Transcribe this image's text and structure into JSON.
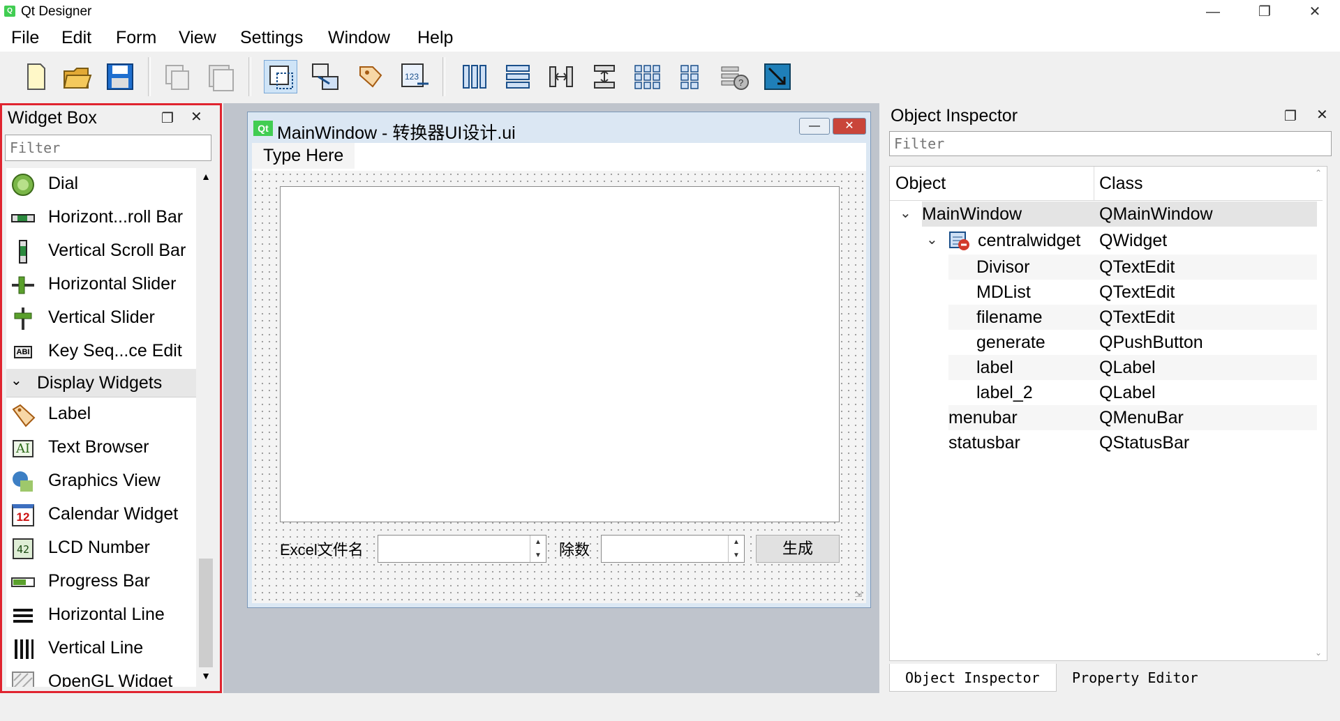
{
  "window": {
    "title": "Qt Designer",
    "icon_text": "Q"
  },
  "menubar": {
    "items": [
      "File",
      "Edit",
      "Form",
      "View",
      "Settings",
      "Window",
      "Help"
    ]
  },
  "toolbar": {
    "buttons": [
      "new-file",
      "open-folder",
      "save",
      "copy",
      "paste",
      "edit-widgets",
      "edit-signals",
      "edit-buddies",
      "edit-tab-order",
      "lay-out-horizontally",
      "lay-out-vertically",
      "lay-out-horizontally-splitter",
      "lay-out-vertically-splitter",
      "lay-out-grid",
      "lay-out-form",
      "break-layout",
      "adjust-size"
    ]
  },
  "widget_box": {
    "title": "Widget Box",
    "filter_placeholder": "Filter",
    "items_top": [
      "Dial",
      "Horizont...roll Bar",
      "Vertical Scroll Bar",
      "Horizontal Slider",
      "Vertical Slider",
      "Key Seq...ce Edit"
    ],
    "category": "Display Widgets",
    "items_bottom": [
      "Label",
      "Text Browser",
      "Graphics View",
      "Calendar Widget",
      "LCD Number",
      "Progress Bar",
      "Horizontal Line",
      "Vertical Line",
      "OpenGL Widget"
    ],
    "calendar_icon_text": "12",
    "lcd_icon_text": "42",
    "key_icon_text": "ABI",
    "text_icon_text": "AI"
  },
  "form_window": {
    "qt_badge": "Qt",
    "title": "MainWindow - 转换器UI设计.ui",
    "menu_placeholder": "Type Here",
    "label_excel": "Excel文件名",
    "label_divisor": "除数",
    "generate_button": "生成"
  },
  "object_inspector": {
    "title": "Object Inspector",
    "filter_placeholder": "Filter",
    "col_object": "Object",
    "col_class": "Class",
    "rows": [
      {
        "name": "MainWindow",
        "class": "QMainWindow"
      },
      {
        "name": "centralwidget",
        "class": "QWidget"
      },
      {
        "name": "Divisor",
        "class": "QTextEdit"
      },
      {
        "name": "MDList",
        "class": "QTextEdit"
      },
      {
        "name": "filename",
        "class": "QTextEdit"
      },
      {
        "name": "generate",
        "class": "QPushButton"
      },
      {
        "name": "label",
        "class": "QLabel"
      },
      {
        "name": "label_2",
        "class": "QLabel"
      },
      {
        "name": "menubar",
        "class": "QMenuBar"
      },
      {
        "name": "statusbar",
        "class": "QStatusBar"
      }
    ],
    "tabs": [
      "Object Inspector",
      "Property Editor"
    ]
  },
  "colors": {
    "highlight_border": "#e0242f",
    "qt_green": "#41cd52",
    "mdi_bg": "#bfc4cc"
  }
}
